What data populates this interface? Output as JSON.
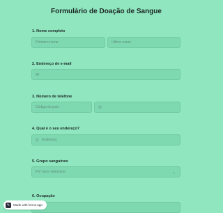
{
  "form": {
    "title": "Formulário de Doação de Sangue",
    "q1": {
      "label": "1. Nome completo",
      "first_placeholder": "Primeiro nome",
      "last_placeholder": "Último nome"
    },
    "q2": {
      "label": "2. Endereço de e-mail",
      "icon": "mail-icon"
    },
    "q3": {
      "label": "3. Número de telefone",
      "code_placeholder": "Código do país",
      "icon": "phone-icon"
    },
    "q4": {
      "label": "4. Qual é o seu endereço?",
      "placeholder": "Endereço",
      "icon": "location-pin-icon"
    },
    "q5": {
      "label": "5. Grupo sanguíneo",
      "selected": "Por favor selecione"
    },
    "q6": {
      "label": "6. Ocupação"
    }
  },
  "badge": {
    "made_with": "Made with forms.app"
  }
}
